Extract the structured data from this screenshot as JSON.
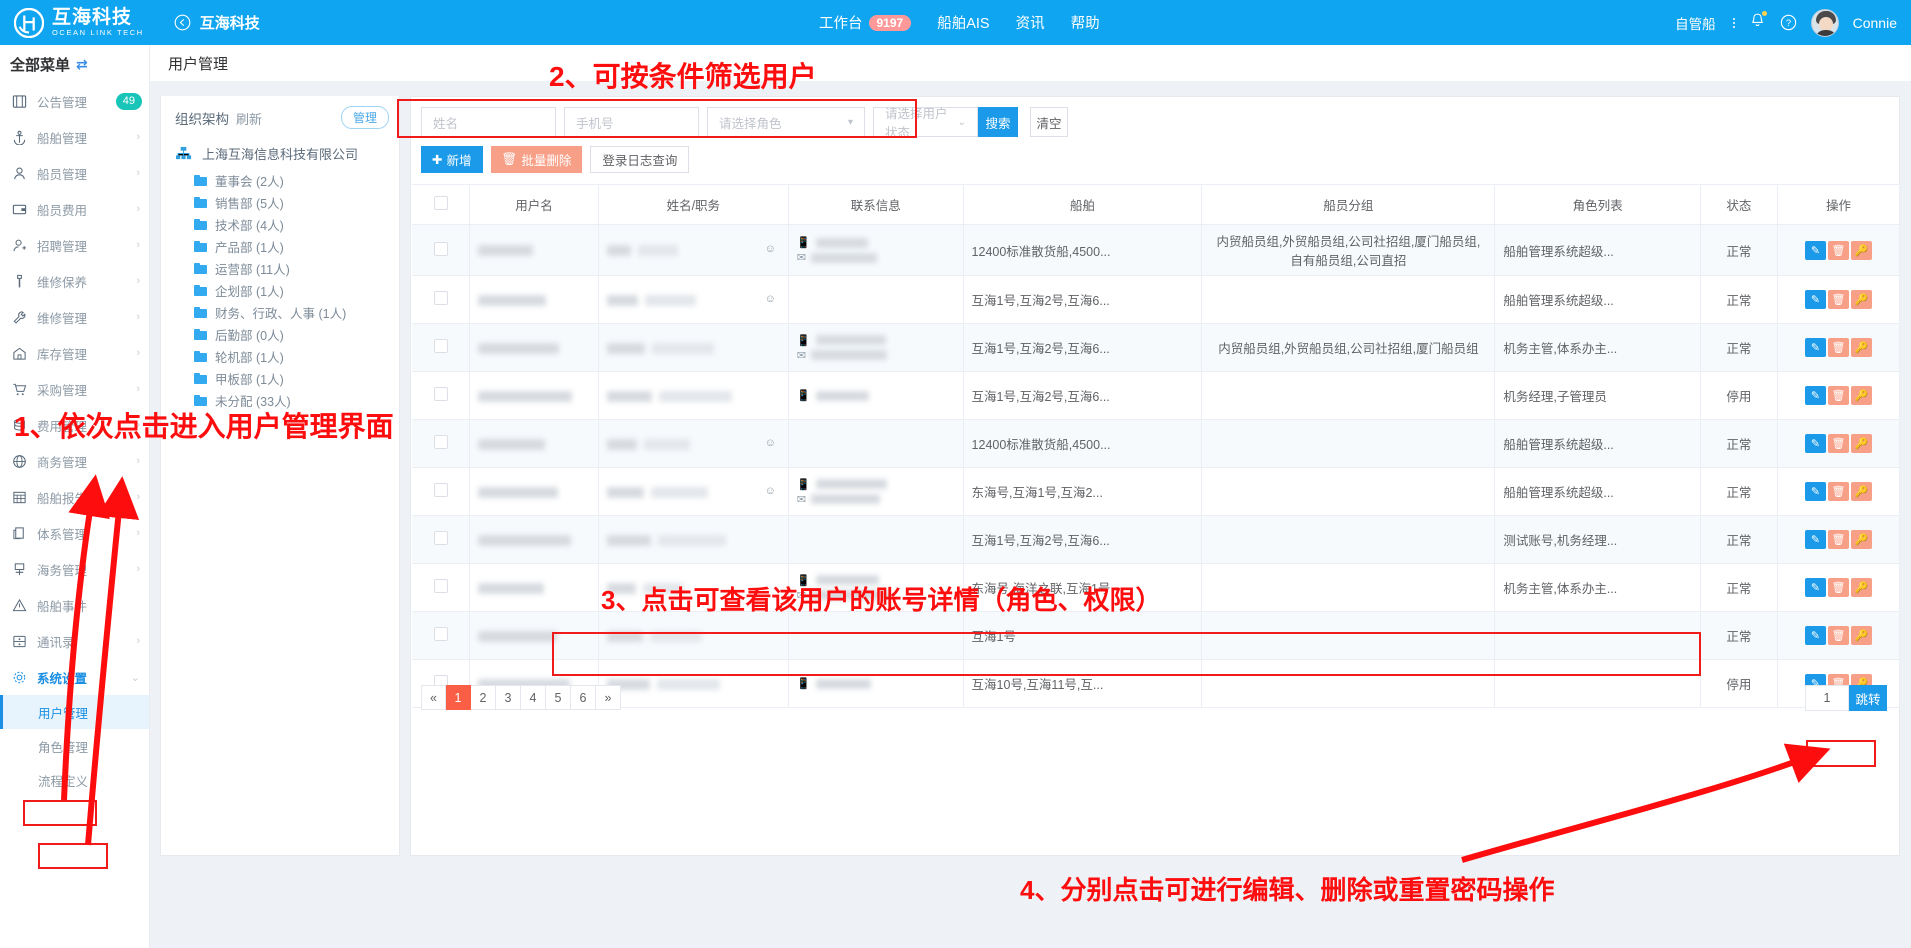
{
  "topbar": {
    "logo_cn": "互海科技",
    "logo_en": "OCEAN LINK TECH",
    "back_label": "互海科技",
    "nav": [
      {
        "label": "工作台",
        "badge": "9197"
      },
      {
        "label": "船舶AIS",
        "badge": ""
      },
      {
        "label": "资讯",
        "badge": ""
      },
      {
        "label": "帮助",
        "badge": ""
      }
    ],
    "self_managed": "自管船",
    "username": "Connie"
  },
  "sidebar": {
    "title": "全部菜单",
    "items": [
      {
        "label": "公告管理",
        "icon": "announcement-icon",
        "badge": "49",
        "chevron": false
      },
      {
        "label": "船舶管理",
        "icon": "anchor-icon",
        "badge": "",
        "chevron": true
      },
      {
        "label": "船员管理",
        "icon": "person-icon",
        "badge": "",
        "chevron": true
      },
      {
        "label": "船员费用",
        "icon": "wallet-icon",
        "badge": "",
        "chevron": true
      },
      {
        "label": "招聘管理",
        "icon": "recruit-icon",
        "badge": "",
        "chevron": true
      },
      {
        "label": "维修保养",
        "icon": "wrench-icon",
        "badge": "",
        "chevron": true
      },
      {
        "label": "维修管理",
        "icon": "spanner-icon",
        "badge": "",
        "chevron": true
      },
      {
        "label": "库存管理",
        "icon": "warehouse-icon",
        "badge": "",
        "chevron": true
      },
      {
        "label": "采购管理",
        "icon": "cart-icon",
        "badge": "",
        "chevron": true
      },
      {
        "label": "费用管理",
        "icon": "coins-icon",
        "badge": "",
        "chevron": true
      },
      {
        "label": "商务管理",
        "icon": "globe-icon",
        "badge": "",
        "chevron": true
      },
      {
        "label": "船舶报告",
        "icon": "report-icon",
        "badge": "",
        "chevron": true
      },
      {
        "label": "体系管理",
        "icon": "docs-icon",
        "badge": "",
        "chevron": true
      },
      {
        "label": "海务管理",
        "icon": "compass-icon",
        "badge": "",
        "chevron": true
      },
      {
        "label": "船舶事件",
        "icon": "warning-icon",
        "badge": "",
        "chevron": false
      },
      {
        "label": "通讯录",
        "icon": "contacts-icon",
        "badge": "",
        "chevron": true
      },
      {
        "label": "系统设置",
        "icon": "gear-icon",
        "badge": "",
        "chevron": true
      }
    ],
    "subitems": [
      {
        "label": "用户管理",
        "current": true
      },
      {
        "label": "角色管理",
        "current": false
      },
      {
        "label": "流程定义",
        "current": false
      }
    ]
  },
  "page": {
    "title": "用户管理"
  },
  "org": {
    "header": "组织架构",
    "refresh": "刷新",
    "manage": "管理",
    "root": "上海互海信息科技有限公司",
    "nodes": [
      "董事会 (2人)",
      "销售部 (5人)",
      "技术部 (4人)",
      "产品部 (1人)",
      "运营部 (11人)",
      "企划部 (1人)",
      "财务、行政、人事 (1人)",
      "后勤部 (0人)",
      "轮机部 (1人)",
      "甲板部 (1人)",
      "未分配 (33人)"
    ]
  },
  "filters": {
    "name_placeholder": "姓名",
    "phone_placeholder": "手机号",
    "role_placeholder": "请选择角色",
    "status_placeholder": "请选择用户状态",
    "search": "搜索",
    "clear": "清空"
  },
  "actions": {
    "add": "新增",
    "batch_delete": "批量删除",
    "login_log": "登录日志查询"
  },
  "table": {
    "headers": [
      "用户名",
      "姓名/职务",
      "联系信息",
      "船舶",
      "船员分组",
      "角色列表",
      "状态",
      "操作"
    ],
    "rows": [
      {
        "ship": "12400标准散货船,4500...",
        "group": "内贸船员组,外贸船员组,公司社招组,厦门船员组,自有船员组,公司直招",
        "role": "船舶管理系统超级...",
        "status": "正常",
        "has_phone": true,
        "has_mail": true,
        "has_person": true
      },
      {
        "ship": "互海1号,互海2号,互海6...",
        "group": "",
        "role": "船舶管理系统超级...",
        "status": "正常",
        "has_phone": false,
        "has_mail": false,
        "has_person": true
      },
      {
        "ship": "互海1号,互海2号,互海6...",
        "group": "内贸船员组,外贸船员组,公司社招组,厦门船员组",
        "role": "机务主管,体系办主...",
        "status": "正常",
        "has_phone": true,
        "has_mail": true,
        "has_person": false
      },
      {
        "ship": "互海1号,互海2号,互海6...",
        "group": "",
        "role": "机务经理,子管理员",
        "status": "停用",
        "has_phone": true,
        "has_mail": false,
        "has_person": false
      },
      {
        "ship": "12400标准散货船,4500...",
        "group": "",
        "role": "船舶管理系统超级...",
        "status": "正常",
        "has_phone": false,
        "has_mail": false,
        "has_person": true
      },
      {
        "ship": "东海号,互海1号,互海2...",
        "group": "",
        "role": "船舶管理系统超级...",
        "status": "正常",
        "has_phone": true,
        "has_mail": true,
        "has_person": true
      },
      {
        "ship": "互海1号,互海2号,互海6...",
        "group": "",
        "role": "测试账号,机务经理...",
        "status": "正常",
        "has_phone": false,
        "has_mail": false,
        "has_person": false
      },
      {
        "ship": "东海号,海洋之联,互海1号",
        "group": "",
        "role": "机务主管,体系办主...",
        "status": "正常",
        "has_phone": true,
        "has_mail": true,
        "has_person": false
      },
      {
        "ship": "互海1号",
        "group": "",
        "role": "",
        "status": "正常",
        "has_phone": false,
        "has_mail": false,
        "has_person": false
      },
      {
        "ship": "互海10号,互海11号,互...",
        "group": "",
        "role": "",
        "status": "停用",
        "has_phone": true,
        "has_mail": false,
        "has_person": false
      }
    ],
    "op_icons": [
      "edit-icon",
      "delete-icon",
      "reset-password-icon"
    ]
  },
  "pagination": {
    "prev": "«",
    "pages": [
      "1",
      "2",
      "3",
      "4",
      "5",
      "6"
    ],
    "next": "»",
    "current": "1",
    "jump_value": "1",
    "jump_label": "跳转"
  },
  "annotations": {
    "a1": "1、依次点击进入用户管理界面",
    "a2": "2、可按条件筛选用户",
    "a3": "3、点击可查看该用户的账号详情（角色、权限）",
    "a4": "4、分别点击可进行编辑、删除或重置密码操作"
  },
  "colors": {
    "brand": "#0fa5f0",
    "accent_blue": "#1a9ae8",
    "salmon": "#f79f87",
    "annotation_red": "#fd0d0d",
    "page_current": "#fa5f45"
  }
}
